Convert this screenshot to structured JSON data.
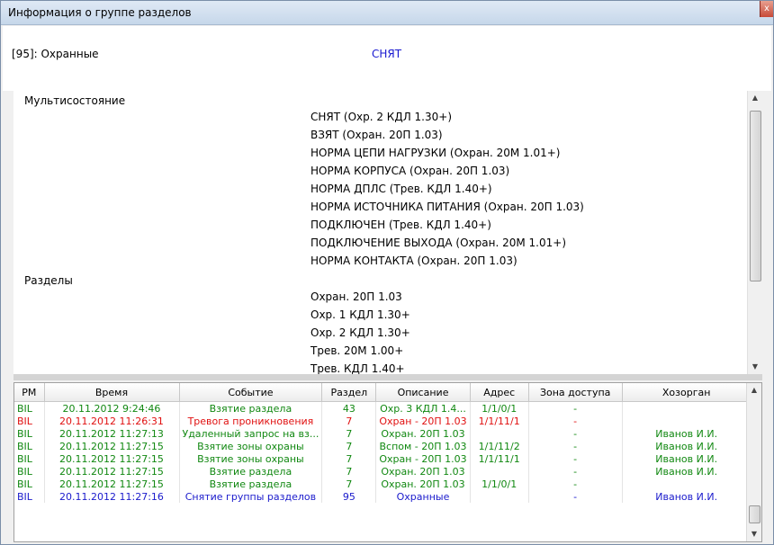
{
  "window": {
    "title": "Информация о группе разделов",
    "close_label": "x"
  },
  "group": {
    "name": "[95]: Охранные",
    "state": "СНЯТ"
  },
  "details": {
    "multistate_label": "Мультисостояние",
    "multistate": [
      "СНЯТ (Охр. 2 КДЛ 1.30+)",
      "ВЗЯТ (Охран. 20П 1.03)",
      "НОРМА ЦЕПИ НАГРУЗКИ (Охран. 20М 1.01+)",
      "НОРМА КОРПУСА (Охран. 20П 1.03)",
      "НОРМА ДПЛС (Трев. КДЛ 1.40+)",
      "НОРМА ИСТОЧНИКА ПИТАНИЯ (Охран. 20П 1.03)",
      "ПОДКЛЮЧЕН (Трев. КДЛ 1.40+)",
      "ПОДКЛЮЧЕНИЕ ВЫХОДА (Охран. 20М 1.01+)",
      "НОРМА КОНТАКТА (Охран. 20П 1.03)"
    ],
    "sections_label": "Разделы",
    "sections": [
      "Охран. 20П 1.03",
      "Охр. 1 КДЛ 1.30+",
      "Охр. 2 КДЛ 1.30+",
      "Трев. 20М 1.00+",
      "Трев. КДЛ 1.40+"
    ]
  },
  "events": {
    "columns": [
      "РМ",
      "Время",
      "Событие",
      "Раздел",
      "Описание",
      "Адрес",
      "Зона доступа",
      "Хозорган"
    ],
    "rows": [
      {
        "color": "green",
        "cells": [
          "BIL",
          "20.11.2012 9:24:46",
          "Взятие раздела",
          "43",
          "Охр. 3 КДЛ 1.4...",
          "1/1/0/1",
          "-",
          ""
        ]
      },
      {
        "color": "red",
        "cells": [
          "BIL",
          "20.11.2012 11:26:31",
          "Тревога проникновения",
          "7",
          "Охран - 20П 1.03",
          "1/1/11/1",
          "-",
          ""
        ]
      },
      {
        "color": "green",
        "cells": [
          "BIL",
          "20.11.2012 11:27:13",
          "Удаленный запрос на вз...",
          "7",
          "Охран. 20П 1.03",
          "",
          "-",
          "Иванов И.И."
        ]
      },
      {
        "color": "green",
        "cells": [
          "BIL",
          "20.11.2012 11:27:15",
          "Взятие зоны охраны",
          "7",
          "Вспом - 20П 1.03",
          "1/1/11/2",
          "-",
          "Иванов И.И."
        ]
      },
      {
        "color": "green",
        "cells": [
          "BIL",
          "20.11.2012 11:27:15",
          "Взятие зоны охраны",
          "7",
          "Охран - 20П 1.03",
          "1/1/11/1",
          "-",
          "Иванов И.И."
        ]
      },
      {
        "color": "green",
        "cells": [
          "BIL",
          "20.11.2012 11:27:15",
          "Взятие раздела",
          "7",
          "Охран. 20П 1.03",
          "",
          "-",
          "Иванов И.И."
        ]
      },
      {
        "color": "green",
        "cells": [
          "BIL",
          "20.11.2012 11:27:15",
          "Взятие раздела",
          "7",
          "Охран. 20П 1.03",
          "1/1/0/1",
          "-",
          ""
        ]
      },
      {
        "color": "blue",
        "cells": [
          "BIL",
          "20.11.2012 11:27:16",
          "Снятие группы разделов",
          "95",
          "Охранные",
          "",
          "-",
          "Иванов И.И."
        ]
      }
    ]
  },
  "icons": {
    "scroll_up": "scroll-up-icon",
    "scroll_down": "scroll-down-icon",
    "close": "close-icon"
  },
  "colors": {
    "state_text": "#1a1ad0",
    "ok": "#118811",
    "alarm": "#e01010",
    "disarm": "#1a1acc"
  }
}
